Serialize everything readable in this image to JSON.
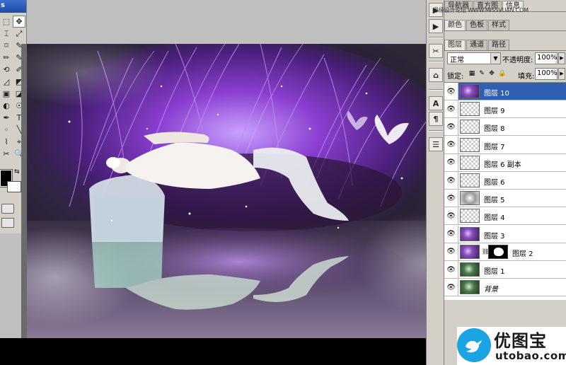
{
  "toolbox": {
    "title": "s",
    "tools_left": [
      "⬚",
      "⌶",
      "⌑",
      "✏",
      "⟲",
      "◿",
      "▣",
      "◐",
      "✒",
      "◦",
      "⌇",
      "✂"
    ],
    "tools_right": [
      "✥",
      "⤢",
      "✎",
      "✎",
      "✐",
      "◩",
      "◪",
      "☉",
      "T",
      "╲",
      "⌖",
      "🔍"
    ]
  },
  "dock": {
    "buttons": [
      "▶",
      "▶",
      "✂",
      "⌂",
      "A",
      "¶",
      "☰"
    ]
  },
  "panels": {
    "watermark": "思缘设计论坛 WWW.MISSVUAN.COM",
    "top_tabs": [
      "导航器",
      "直方图",
      "信息"
    ],
    "color_tabs": [
      "颜色",
      "色板",
      "样式"
    ],
    "layer_tabs": [
      "图层",
      "通道",
      "路径"
    ],
    "blend_mode": "正常",
    "opacity_label": "不透明度:",
    "opacity_value": "100%",
    "lock_label": "锁定:",
    "fill_label": "填充:",
    "fill_value": "100%",
    "layers": [
      {
        "name": "图层 10",
        "thumb": "purple",
        "selected": true
      },
      {
        "name": "图层 9",
        "thumb": "transparent"
      },
      {
        "name": "图层 8",
        "thumb": "transparent"
      },
      {
        "name": "图层 7",
        "thumb": "transparent"
      },
      {
        "name": "图层 6 副本",
        "thumb": "transparent"
      },
      {
        "name": "图层 6",
        "thumb": "transparent"
      },
      {
        "name": "图层 5",
        "thumb": "fog"
      },
      {
        "name": "图层 4",
        "thumb": "transparent"
      },
      {
        "name": "图层 3",
        "thumb": "purple"
      },
      {
        "name": "图层 2",
        "thumb": "purple",
        "mask": true
      },
      {
        "name": "图层 1",
        "thumb": "green"
      },
      {
        "name": "背景",
        "thumb": "green",
        "italic": true
      }
    ]
  },
  "logo": {
    "cn": "优图宝",
    "en": "utobao.com",
    "color": "#1aa4e4"
  }
}
